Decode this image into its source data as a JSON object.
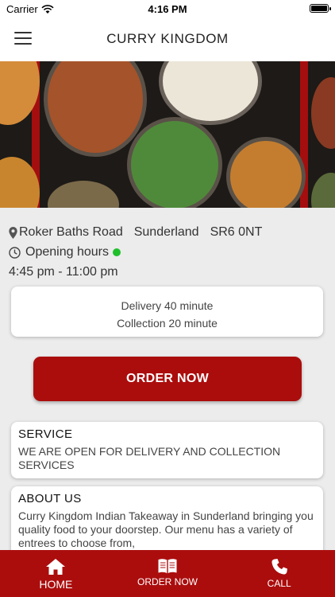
{
  "status_bar": {
    "carrier": "Carrier",
    "time": "4:16 PM"
  },
  "app_bar": {
    "title": "CURRY KINGDOM"
  },
  "info": {
    "street": "Roker Baths Road",
    "city": "Sunderland",
    "postcode": "SR6 0NT",
    "opening_label": "Opening hours",
    "hours": "4:45 pm - 11:00 pm"
  },
  "times": {
    "delivery": "Delivery 40 minute",
    "collection": "Collection 20 minute"
  },
  "order_button": "ORDER NOW",
  "service": {
    "title": "SERVICE",
    "text": "WE ARE OPEN FOR DELIVERY AND COLLECTION SERVICES"
  },
  "about": {
    "title": "ABOUT US",
    "text": "Curry Kingdom Indian Takeaway in Sunderland bringing you quality food to your doorstep. Our menu has a variety of entrees to choose from,"
  },
  "bottom_nav": {
    "home": "HOME",
    "order": "ORDER NOW",
    "call": "CALL"
  },
  "colors": {
    "brand_red": "#ab0d0d",
    "open_status": "#1fbf2c"
  }
}
